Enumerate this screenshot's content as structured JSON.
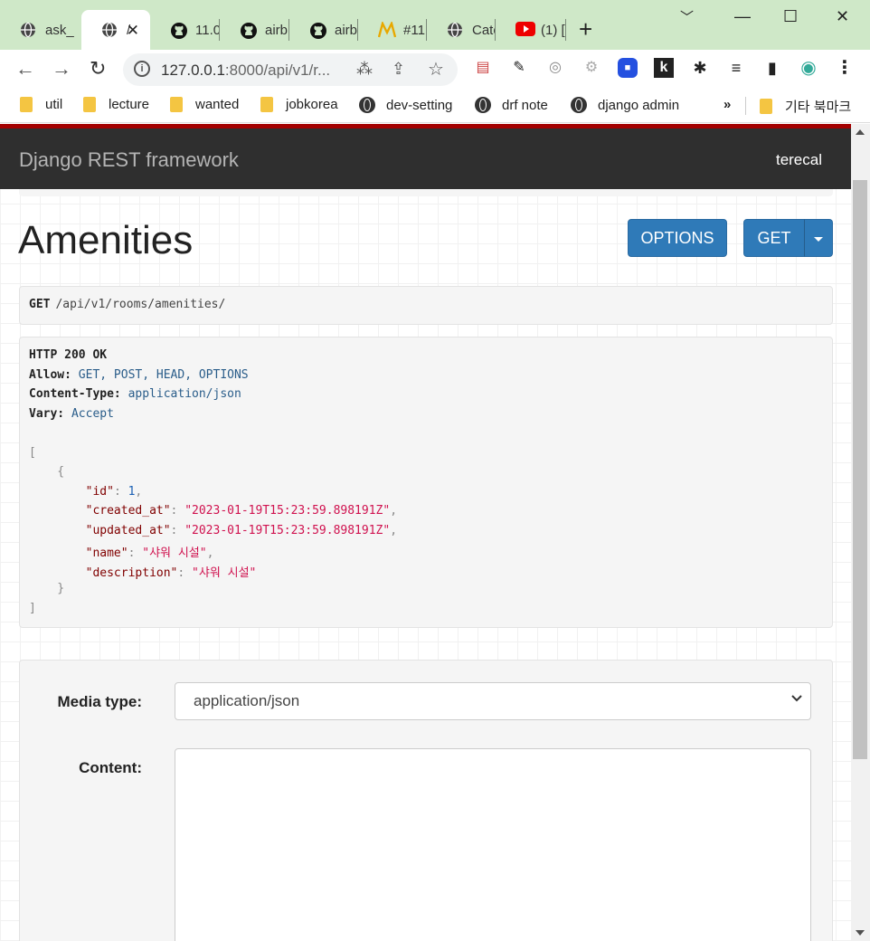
{
  "browser": {
    "tabs": [
      {
        "label": "ask_",
        "icon": "globe-icon",
        "active": false
      },
      {
        "label": "/",
        "icon": "globe-icon",
        "active": true
      },
      {
        "label": "11.0",
        "icon": "github-icon",
        "active": false
      },
      {
        "label": "airb",
        "icon": "github-icon",
        "active": false
      },
      {
        "label": "airb",
        "icon": "github-icon",
        "active": false
      },
      {
        "label": "#11",
        "icon": "m-logo-icon",
        "active": false
      },
      {
        "label": "Cate",
        "icon": "globe-icon",
        "active": false
      },
      {
        "label": "(1) [",
        "icon": "youtube-icon",
        "active": false
      }
    ],
    "tab_close": "✕",
    "new_tab": "+",
    "window_controls": {
      "menu": "﹀",
      "minimize": "—",
      "maximize": "☐",
      "close": "✕"
    },
    "nav": {
      "back": "←",
      "forward": "→",
      "reload": "↻"
    },
    "url": {
      "host": "127.0.0.1",
      "rest": ":8000/api/v1/r..."
    },
    "omnibox_icons": {
      "translate": "⁂",
      "share": "⇪",
      "bookmark_star": "☆"
    },
    "extensions": [
      "▤",
      "✎",
      "◎",
      "⚙",
      "■",
      "k",
      "✱",
      "≡",
      "▮",
      "◉",
      "⋮"
    ],
    "bookmarks": [
      {
        "label": "util",
        "type": "folder"
      },
      {
        "label": "lecture",
        "type": "folder"
      },
      {
        "label": "wanted",
        "type": "folder"
      },
      {
        "label": "jobkorea",
        "type": "folder"
      },
      {
        "label": "dev-setting",
        "type": "site"
      },
      {
        "label": "drf note",
        "type": "site"
      },
      {
        "label": "django admin",
        "type": "site"
      }
    ],
    "bookmarks_more": "»",
    "other_bookmarks": "기타 북마크"
  },
  "page": {
    "brand": "Django REST framework",
    "user": "terecal",
    "title": "Amenities",
    "options_button": "OPTIONS",
    "get_button": "GET",
    "request": {
      "method": "GET",
      "path": "/api/v1/rooms/amenities/"
    },
    "response": {
      "status": "HTTP 200 OK",
      "headers": [
        {
          "key": "Allow:",
          "value": "GET, POST, HEAD, OPTIONS"
        },
        {
          "key": "Content-Type:",
          "value": "application/json"
        },
        {
          "key": "Vary:",
          "value": "Accept"
        }
      ],
      "body": {
        "id": "1",
        "created_at": "\"2023-01-19T15:23:59.898191Z\"",
        "updated_at": "\"2023-01-19T15:23:59.898191Z\"",
        "name": "\"샤워 시설\"",
        "description": "\"샤워 시설\""
      }
    },
    "form": {
      "media_type_label": "Media type:",
      "media_type_value": "application/json",
      "content_label": "Content:"
    }
  },
  "colors": {
    "navbar": "#2f2f2f",
    "accent_red": "#a30000",
    "button_blue": "#2f7ab8",
    "tabstrip": "#cfe8c8"
  }
}
